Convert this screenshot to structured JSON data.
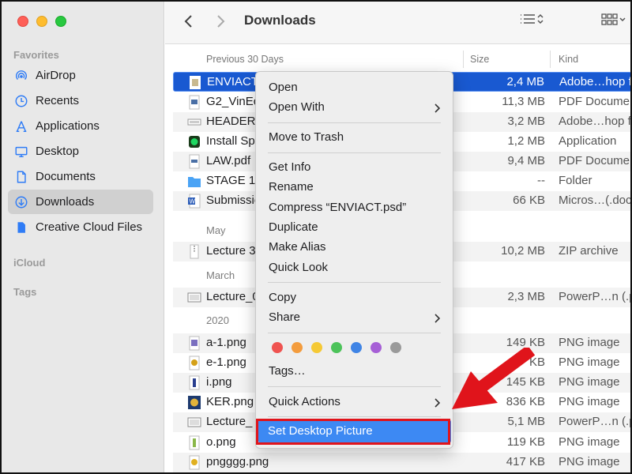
{
  "sidebar": {
    "favorites_label": "Favorites",
    "items": [
      {
        "label": "AirDrop",
        "icon": "airdrop-icon"
      },
      {
        "label": "Recents",
        "icon": "clock-icon"
      },
      {
        "label": "Applications",
        "icon": "applications-icon"
      },
      {
        "label": "Desktop",
        "icon": "desktop-icon"
      },
      {
        "label": "Documents",
        "icon": "document-icon"
      },
      {
        "label": "Downloads",
        "icon": "download-icon",
        "selected": true
      },
      {
        "label": "Creative Cloud Files",
        "icon": "file-icon"
      }
    ],
    "icloud_label": "iCloud",
    "tags_label": "Tags"
  },
  "toolbar": {
    "title": "Downloads"
  },
  "columns": {
    "name": "Previous 30 Days",
    "size": "Size",
    "kind": "Kind"
  },
  "groups": {
    "may": "May",
    "march": "March",
    "y2020": "2020"
  },
  "files": [
    {
      "name": "ENVIACT.psd",
      "size": "2,4 MB",
      "kind": "Adobe…hop file"
    },
    {
      "name": "G2_VinEco",
      "size": "11,3 MB",
      "kind": "PDF Document"
    },
    {
      "name": "HEADER.psd",
      "size": "3,2 MB",
      "kind": "Adobe…hop file"
    },
    {
      "name": "Install Spotify",
      "size": "1,2 MB",
      "kind": "Application"
    },
    {
      "name": "LAW.pdf",
      "size": "9,4 MB",
      "kind": "PDF Document"
    },
    {
      "name": "STAGE 1",
      "size": "--",
      "kind": "Folder"
    },
    {
      "name": "Submission",
      "size": "66 KB",
      "kind": "Micros…(.docx)"
    },
    {
      "name": "Lecture 3",
      "size": "10,2 MB",
      "kind": "ZIP archive"
    },
    {
      "name": "Lecture_0",
      "size": "2,3 MB",
      "kind": "PowerP…n (.pptx)"
    },
    {
      "name": "a-1.png",
      "size": "149 KB",
      "kind": "PNG image"
    },
    {
      "name": "e-1.png",
      "size": "?? KB",
      "kind": "PNG image"
    },
    {
      "name": "i.png",
      "size": "145 KB",
      "kind": "PNG image"
    },
    {
      "name": "KER.png",
      "size": "836 KB",
      "kind": "PNG image"
    },
    {
      "name": "Lecture_",
      "size": "5,1 MB",
      "kind": "PowerP…n (.pptx)"
    },
    {
      "name": "o.png",
      "size": "119 KB",
      "kind": "PNG image"
    },
    {
      "name": "pngggg.png",
      "size": "417 KB",
      "kind": "PNG image"
    }
  ],
  "menu": {
    "open": "Open",
    "open_with": "Open With",
    "move_to_trash": "Move to Trash",
    "get_info": "Get Info",
    "rename": "Rename",
    "compress": "Compress “ENVIACT.psd”",
    "duplicate": "Duplicate",
    "make_alias": "Make Alias",
    "quick_look": "Quick Look",
    "copy": "Copy",
    "share": "Share",
    "tags": "Tags…",
    "quick_actions": "Quick Actions",
    "set_desktop_picture": "Set Desktop Picture",
    "tag_colors": [
      "#ef5350",
      "#f39c3d",
      "#f5c935",
      "#4cc35a",
      "#3f84e5",
      "#a65fd6",
      "#9a9a9a"
    ]
  },
  "colors": {
    "selection": "#1959d1",
    "highlight": "#3d89f3",
    "annotation": "#e0141b"
  }
}
